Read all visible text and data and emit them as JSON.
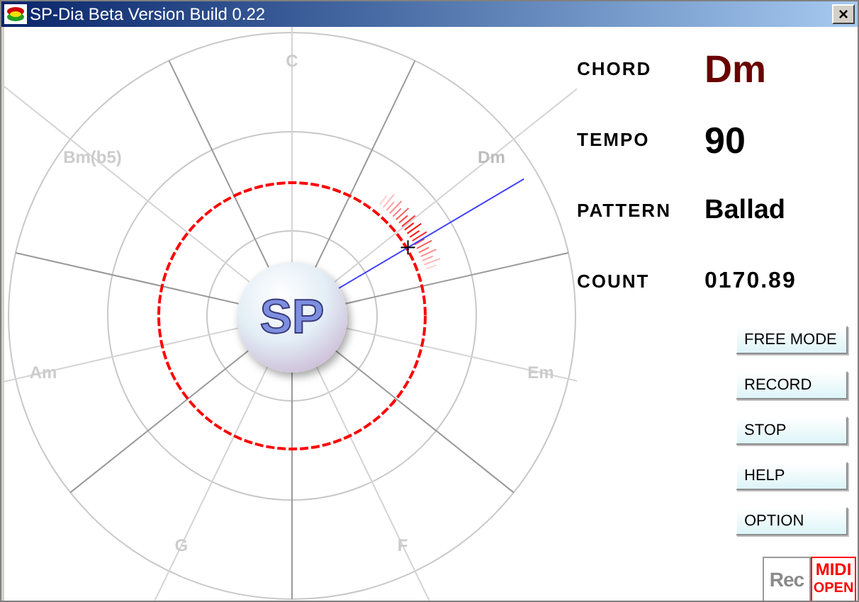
{
  "window": {
    "title": "SP-Dia Beta Version Build 0.22",
    "close": "×"
  },
  "dial": {
    "logo": "SP",
    "chords": [
      {
        "name": "C",
        "selected": false
      },
      {
        "name": "Dm",
        "selected": true
      },
      {
        "name": "Em",
        "selected": false
      },
      {
        "name": "F",
        "selected": false
      },
      {
        "name": "G",
        "selected": false
      },
      {
        "name": "Am",
        "selected": false
      },
      {
        "name": "Bm(b5)",
        "selected": false
      }
    ]
  },
  "readouts": [
    {
      "kind": "chord",
      "label": "CHORD",
      "value": "Dm"
    },
    {
      "kind": "number",
      "label": "TEMPO",
      "value": "90"
    },
    {
      "kind": "text",
      "label": "PATTERN",
      "value": "Ballad"
    },
    {
      "kind": "counter",
      "label": "COUNT",
      "value": "0170.89"
    }
  ],
  "buttons": [
    "FREE MODE",
    "RECORD",
    "STOP",
    "HELP",
    "OPTION"
  ],
  "indicators": {
    "rec": {
      "label": "Rec",
      "on": false
    },
    "midi": {
      "lines": [
        "MIDI",
        "OPEN"
      ],
      "on": true
    }
  }
}
